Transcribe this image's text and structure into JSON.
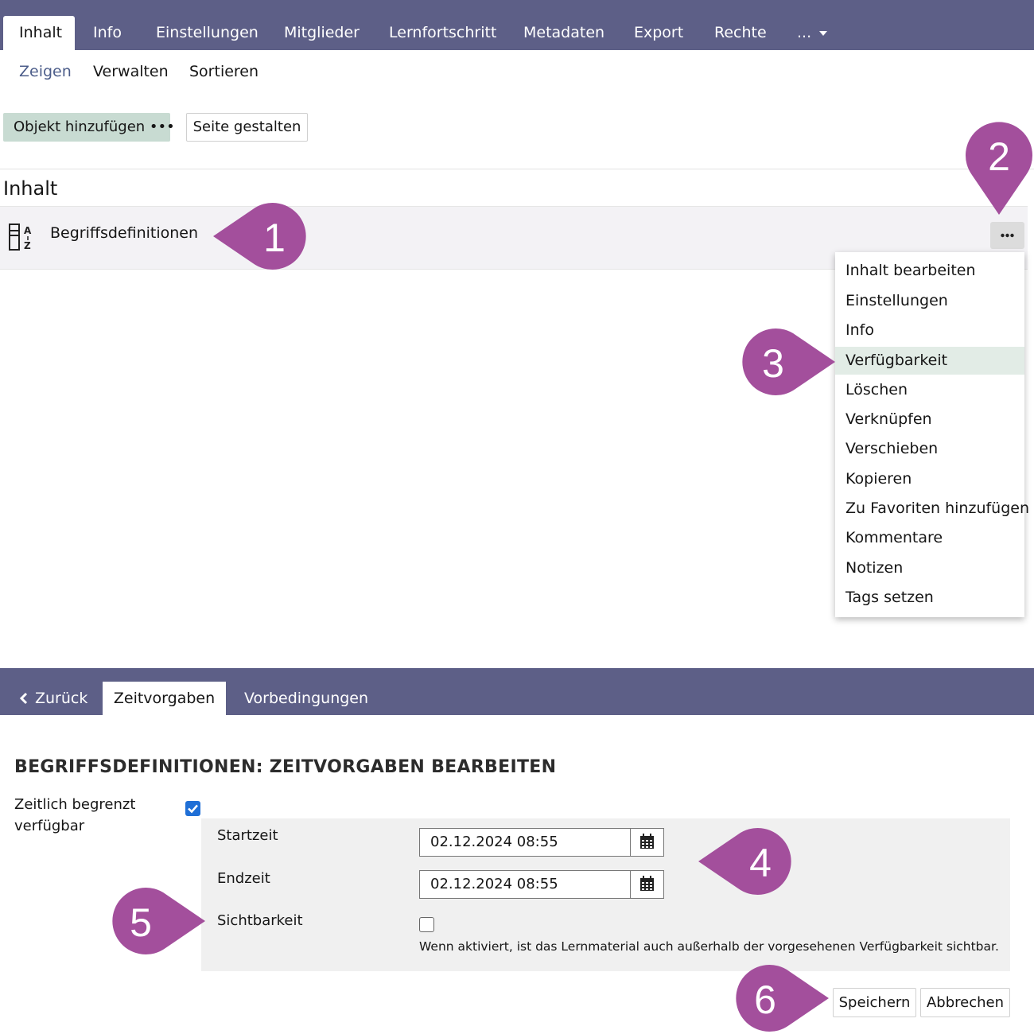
{
  "top_tabs": [
    "Inhalt",
    "Info",
    "Einstellungen",
    "Mitglieder",
    "Lernfortschritt",
    "Metadaten",
    "Export",
    "Rechte",
    "..."
  ],
  "sub_tabs": [
    "Zeigen",
    "Verwalten",
    "Sortieren"
  ],
  "toolbar": {
    "add_label": "Objekt hinzufügen •••",
    "page_label": "Seite gestalten"
  },
  "content": {
    "section_title": "Inhalt",
    "item_label": "Begriffsdefinitionen",
    "more_label": "•••"
  },
  "action_menu": [
    "Inhalt bearbeiten",
    "Einstellungen",
    "Info",
    "Verfügbarkeit",
    "Löschen",
    "Verknüpfen",
    "Verschieben",
    "Kopieren",
    "Zu Favoriten hinzufügen",
    "Kommentare",
    "Notizen",
    "Tags setzen"
  ],
  "form_tabs": {
    "back": "Zurück",
    "active": "Zeitvorgaben",
    "other": "Vorbedingungen"
  },
  "form": {
    "title": "BEGRIFFSDEFINITIONEN: ZEITVORGABEN BEARBEITEN",
    "limited_label_1": "Zeitlich begrenzt",
    "limited_label_2": "verfügbar",
    "start_label": "Startzeit",
    "start_value": "02.12.2024 08:55",
    "end_label": "Endzeit",
    "end_value": "02.12.2024 08:55",
    "visibility_label": "Sichtbarkeit",
    "visibility_hint": "Wenn aktiviert, ist das Lernmaterial auch außerhalb der vorgesehenen Verfügbarkeit sichtbar.",
    "save_label": "Speichern",
    "cancel_label": "Abbrechen"
  },
  "callouts": [
    "1",
    "2",
    "3",
    "4",
    "5",
    "6"
  ],
  "colors": {
    "tabbar": "#5d5f87",
    "callout": "#a34f9c",
    "primary_button": "#c8dbd2",
    "menu_highlight": "#e2ece6",
    "checkbox": "#1f6fd6"
  }
}
